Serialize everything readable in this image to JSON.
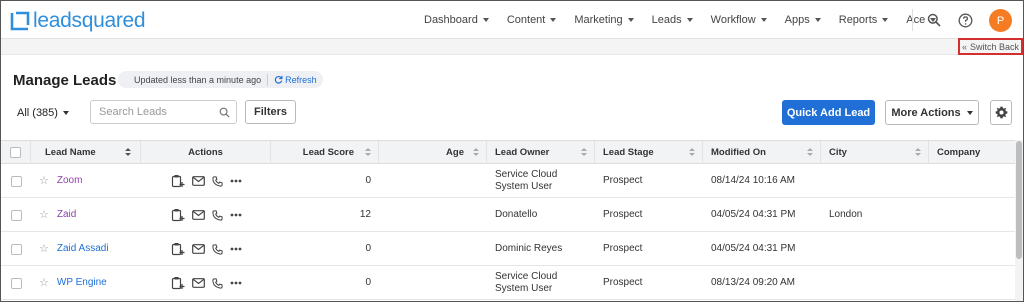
{
  "brand": {
    "name_lead": "lead",
    "name_rest": "squared"
  },
  "nav": {
    "items": [
      {
        "label": "Dashboard"
      },
      {
        "label": "Content"
      },
      {
        "label": "Marketing"
      },
      {
        "label": "Leads"
      },
      {
        "label": "Workflow"
      },
      {
        "label": "Apps"
      },
      {
        "label": "Reports"
      },
      {
        "label": "Ace"
      }
    ],
    "avatar_initial": "P",
    "icons": [
      "search-icon",
      "help-icon"
    ]
  },
  "switch_back": {
    "label": "Switch Back"
  },
  "page": {
    "title": "Manage Leads",
    "status": "Updated less than a minute ago",
    "refresh_label": "Refresh"
  },
  "toolbar": {
    "filter_selected": "All (385)",
    "search_placeholder": "Search Leads",
    "filters_label": "Filters",
    "quick_add_label": "Quick Add Lead",
    "more_actions_label": "More Actions"
  },
  "table": {
    "columns": {
      "lead_name": "Lead Name",
      "actions": "Actions",
      "lead_score": "Lead Score",
      "age": "Age",
      "lead_owner": "Lead Owner",
      "lead_stage": "Lead Stage",
      "modified_on": "Modified On",
      "city": "City",
      "company": "Company"
    },
    "rows": [
      {
        "name": "Zoom",
        "name_color": "#8e44ad",
        "score": "0",
        "age": "",
        "owner": "Service Cloud System User",
        "stage": "Prospect",
        "modified": "08/14/24 10:16 AM",
        "city": "",
        "company": ""
      },
      {
        "name": "Zaid",
        "name_color": "#8e44ad",
        "score": "12",
        "age": "",
        "owner": "Donatello",
        "stage": "Prospect",
        "modified": "04/05/24 04:31 PM",
        "city": "London",
        "company": ""
      },
      {
        "name": "Zaid Assadi",
        "name_color": "#1f6fd6",
        "score": "0",
        "age": "",
        "owner": "Dominic Reyes",
        "stage": "Prospect",
        "modified": "04/05/24 04:31 PM",
        "city": "",
        "company": ""
      },
      {
        "name": "WP Engine",
        "name_color": "#1f6fd6",
        "score": "0",
        "age": "",
        "owner": "Service Cloud System User",
        "stage": "Prospect",
        "modified": "08/13/24 09:20 AM",
        "city": "",
        "company": ""
      }
    ]
  },
  "colors": {
    "accent": "#1f6fd6",
    "avatar": "#f57c22",
    "switch_back_border": "#d32f2f"
  }
}
